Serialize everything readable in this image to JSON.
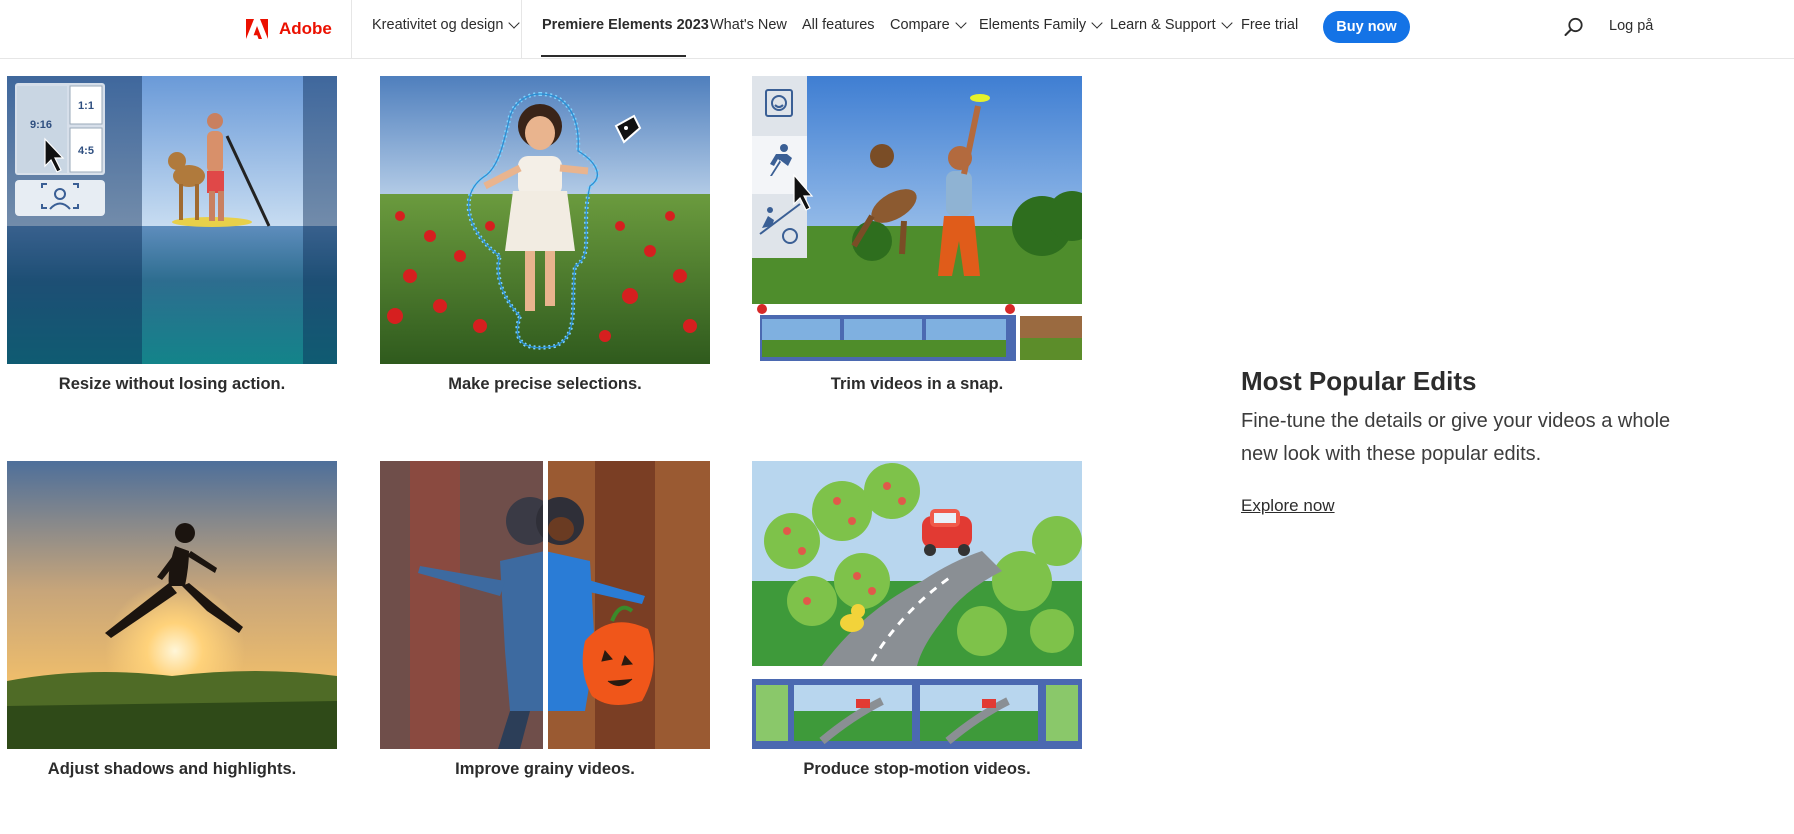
{
  "header": {
    "brand": "Adobe",
    "nav": [
      {
        "label": "Kreativitet og design",
        "dropdown": true
      },
      {
        "label": "Premiere Elements 2023",
        "active": true
      },
      {
        "label": "What's New"
      },
      {
        "label": "All features"
      },
      {
        "label": "Compare",
        "dropdown": true
      },
      {
        "label": "Elements Family",
        "dropdown": true
      },
      {
        "label": "Learn & Support",
        "dropdown": true
      },
      {
        "label": "Free trial"
      }
    ],
    "buy_label": "Buy now",
    "login_label": "Log på",
    "search_icon": "search-icon",
    "accent": "#1473e6",
    "brand_color": "#eb1000"
  },
  "grid": {
    "items": [
      {
        "caption": "Resize without losing action."
      },
      {
        "caption": "Make precise selections."
      },
      {
        "caption": "Trim videos in a snap."
      },
      {
        "caption": "Adjust shadows and highlights."
      },
      {
        "caption": "Improve grainy videos."
      },
      {
        "caption": "Produce stop-motion videos."
      }
    ],
    "overlay_labels": {
      "ratio_916": "9:16",
      "ratio_11": "1:1",
      "ratio_45": "4:5"
    }
  },
  "promo": {
    "title": "Most Popular Edits",
    "body": "Fine-tune the details or give your videos a whole new look with these popular edits.",
    "link": "Explore now"
  }
}
